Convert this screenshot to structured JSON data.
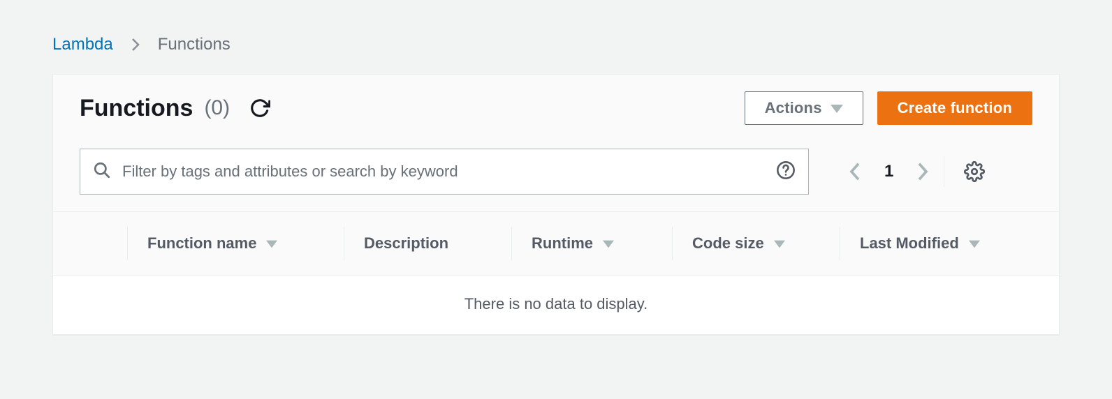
{
  "breadcrumb": {
    "root": "Lambda",
    "current": "Functions"
  },
  "header": {
    "title": "Functions",
    "count": "(0)"
  },
  "buttons": {
    "actions": "Actions",
    "create": "Create function"
  },
  "search": {
    "placeholder": "Filter by tags and attributes or search by keyword"
  },
  "pagination": {
    "page": "1"
  },
  "columns": {
    "name": "Function name",
    "description": "Description",
    "runtime": "Runtime",
    "codesize": "Code size",
    "modified": "Last Modified"
  },
  "empty": "There is no data to display."
}
